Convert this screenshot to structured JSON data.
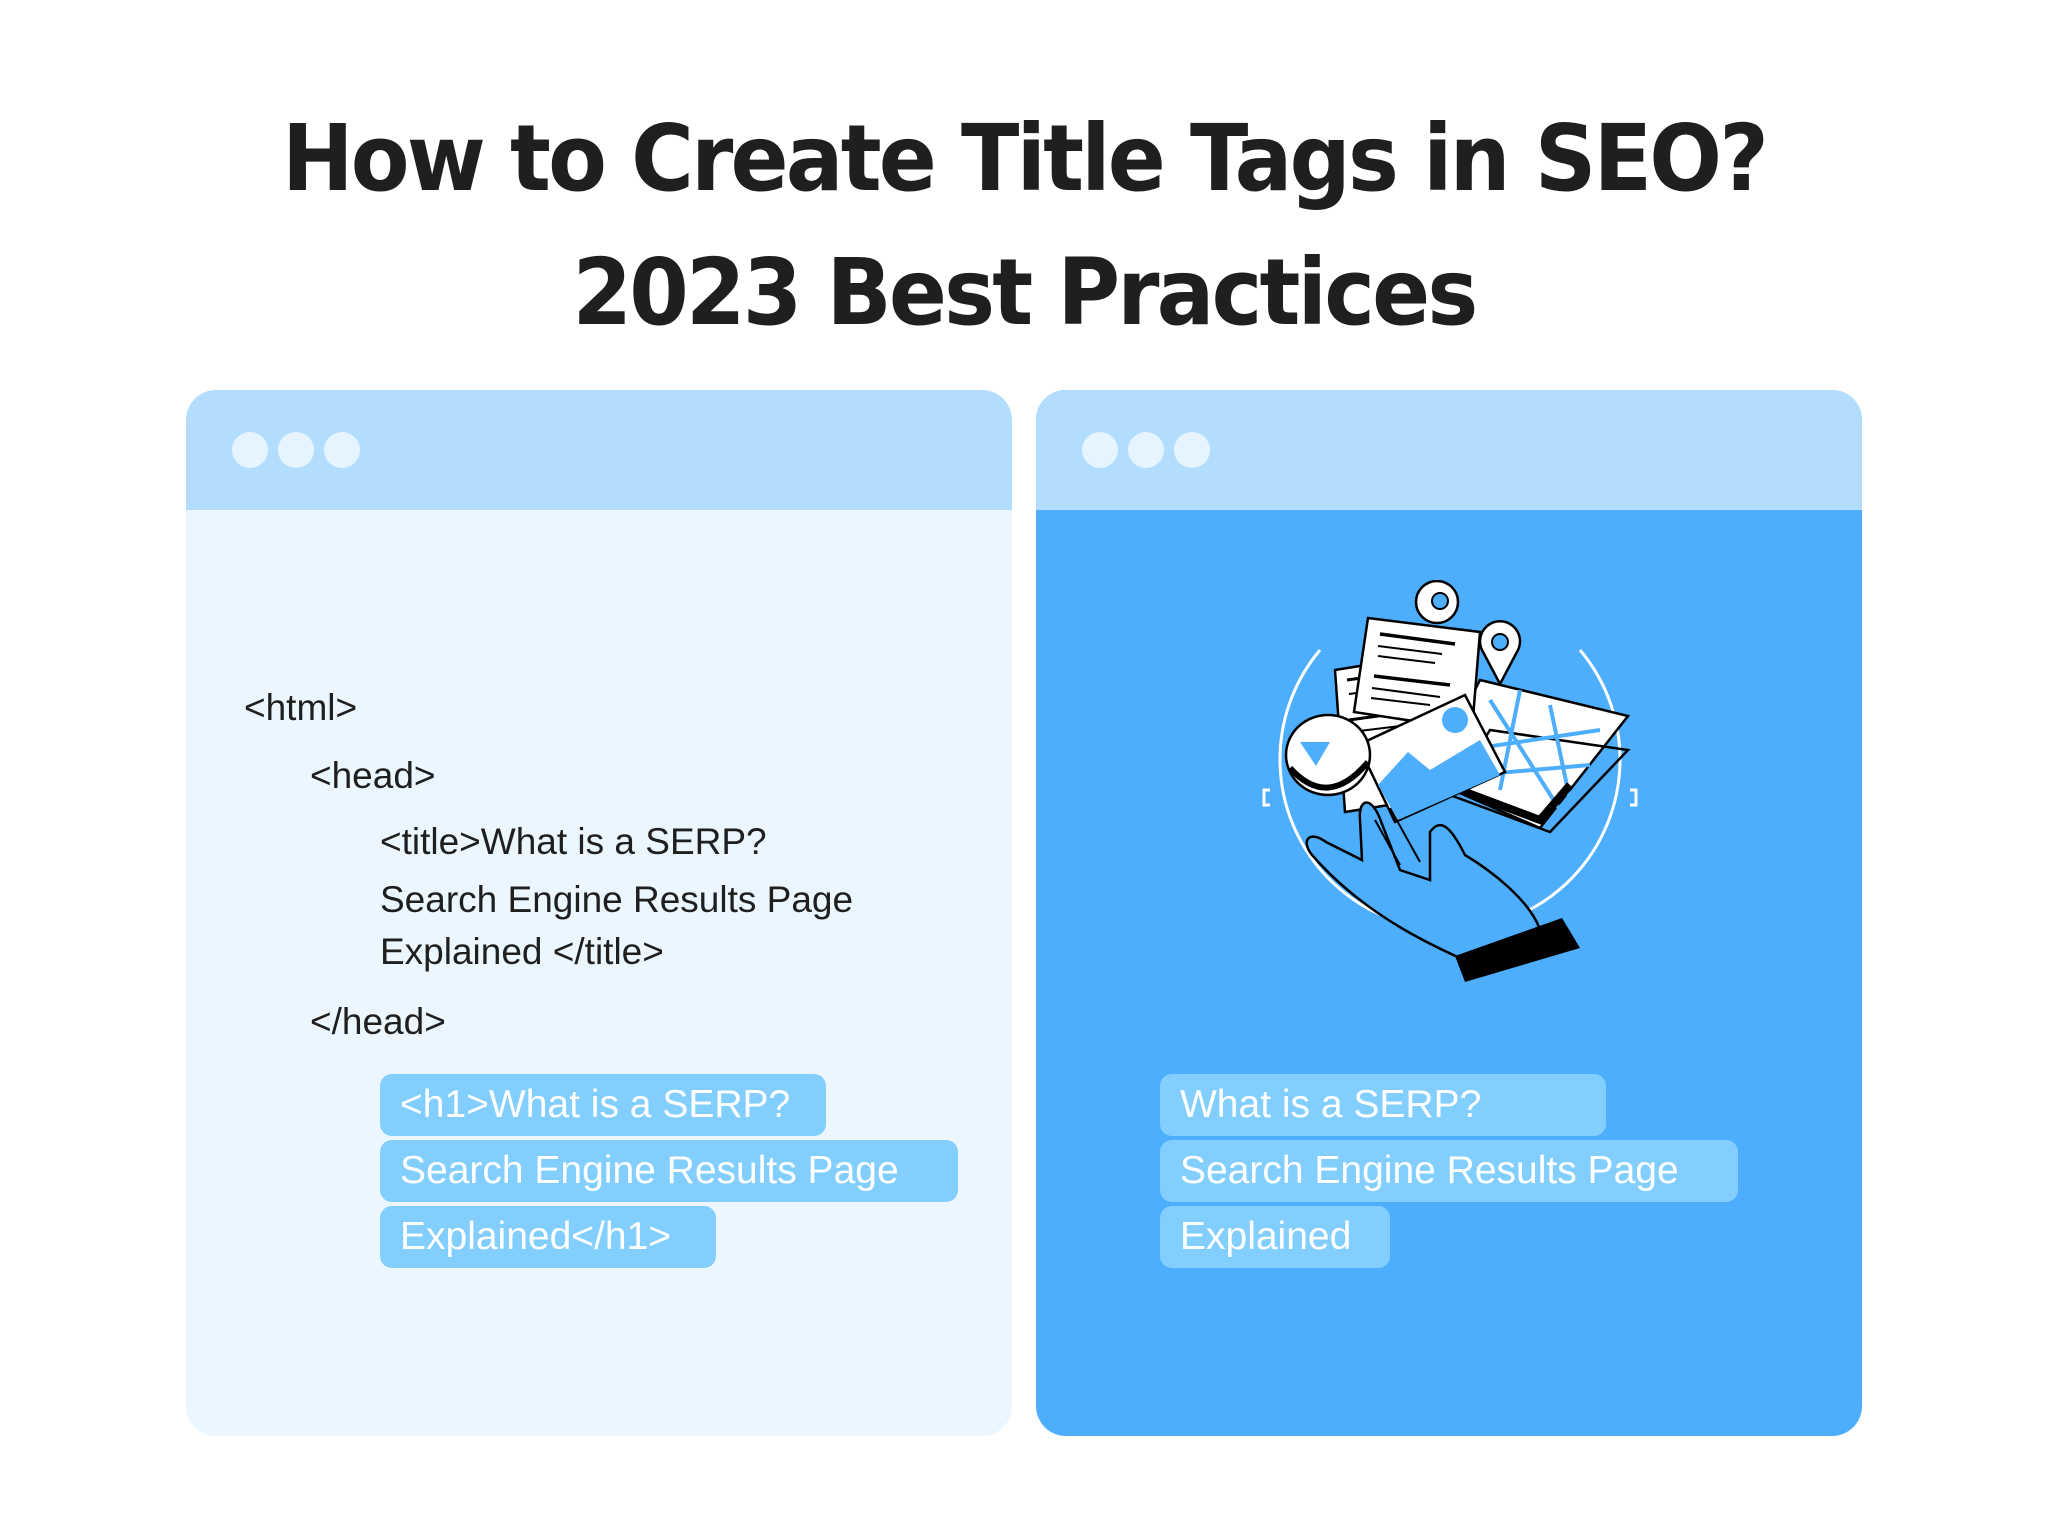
{
  "title": {
    "line1": "How to Create Title Tags in SEO?",
    "line2": "2023 Best Practices"
  },
  "colors": {
    "header_bar": "#b3ddff",
    "window_dots": "#e6f4ff",
    "left_body": "#ebf6ff",
    "right_body": "#4daefe",
    "chip": "#82cfff",
    "text_dark": "#1f1f1f"
  },
  "left_window": {
    "code_lines": {
      "html_open": "<html>",
      "head_open": "<head>",
      "title_line1": "<title>What is a SERP?",
      "title_line2": "Search Engine Results Page",
      "title_line3": "Explained </title>",
      "head_close": "</head>"
    },
    "h1_chips": [
      "<h1>What is a SERP?",
      "Search Engine Results Page",
      "Explained</h1>"
    ]
  },
  "right_window": {
    "illustration": "hand-holding-documents-map-pins-icon",
    "h1_chips": [
      "What is a SERP?",
      "Search Engine Results Page",
      "Explained"
    ]
  }
}
